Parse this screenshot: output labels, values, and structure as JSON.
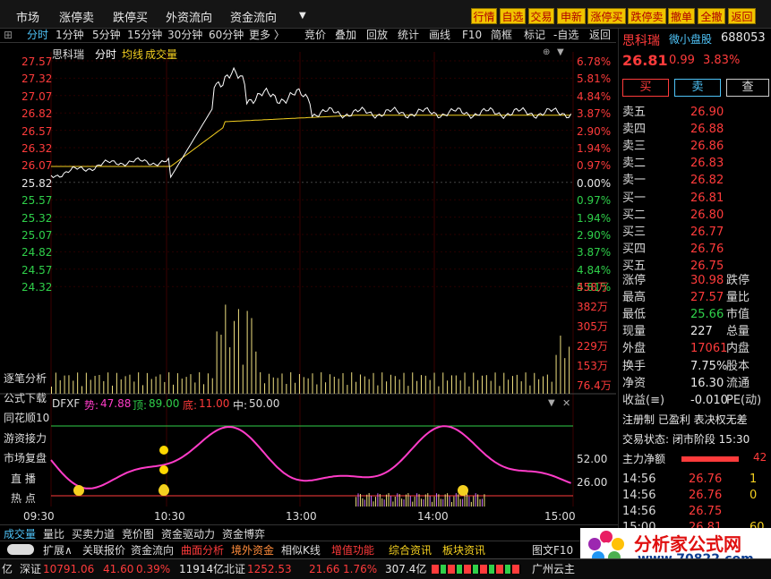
{
  "topbar": {
    "menu": [
      "市场",
      "涨停卖",
      "跌停买",
      "外资流向",
      "资金流向"
    ],
    "buttons": [
      "行情",
      "自选",
      "交易",
      "申新",
      "涨停买",
      "跌停卖",
      "撤单",
      "全撤",
      "返回"
    ]
  },
  "tabs": {
    "periods": [
      "分时",
      "1分钟",
      "5分钟",
      "15分钟",
      "30分钟",
      "60分钟",
      "更多 〉"
    ],
    "tools": [
      "竞价",
      "叠加",
      "回放",
      "统计",
      "画线",
      "F10",
      "简框",
      "标记",
      "-自选",
      "返回"
    ]
  },
  "chart_header": {
    "name": "思科瑞",
    "mode": "分时",
    "avg_label": "均线",
    "vol_label": "成交量"
  },
  "price_axis": {
    "left": [
      "27.57",
      "27.32",
      "27.07",
      "26.82",
      "26.57",
      "26.32",
      "26.07",
      "25.82",
      "25.57",
      "25.32",
      "25.07",
      "24.82",
      "24.57",
      "24.32"
    ],
    "right": [
      "6.78%",
      "5.81%",
      "4.84%",
      "3.87%",
      "2.90%",
      "1.94%",
      "0.97%",
      "0.00%",
      "0.97%",
      "1.94%",
      "2.90%",
      "3.87%",
      "4.84%",
      "5.81%"
    ]
  },
  "volume_axis": [
    "458万",
    "382万",
    "305万",
    "229万",
    "153万",
    "76.4万"
  ],
  "indicator": {
    "name": "DFXF",
    "shi_label": "势:",
    "shi_value": "47.88",
    "ding_label": "顶:",
    "ding_value": "89.00",
    "di_label": "底:",
    "di_value": "11.00",
    "zhong_label": "中:",
    "zhong_value": "50.00",
    "axis": [
      "52.00",
      "26.00"
    ]
  },
  "time_axis": [
    "09:30",
    "10:30",
    "13:00",
    "14:00",
    "15:00"
  ],
  "side_labels": [
    "逐笔分析",
    "公式下载",
    "同花顺10",
    "游资接力",
    "市场复盘",
    "直 播",
    "热 点"
  ],
  "quote": {
    "name": "思科瑞",
    "tag": "微小盘股",
    "code": "688053",
    "price": "26.81",
    "change": "0.99",
    "pct": "3.83%",
    "buy_btn": "买",
    "sell_btn": "卖",
    "view_btn": "查",
    "asks": [
      {
        "l": "卖五",
        "p": "26.90"
      },
      {
        "l": "卖四",
        "p": "26.88"
      },
      {
        "l": "卖三",
        "p": "26.86"
      },
      {
        "l": "卖二",
        "p": "26.83"
      },
      {
        "l": "卖一",
        "p": "26.82"
      }
    ],
    "bids": [
      {
        "l": "买一",
        "p": "26.81"
      },
      {
        "l": "买二",
        "p": "26.80"
      },
      {
        "l": "买三",
        "p": "26.77"
      },
      {
        "l": "买四",
        "p": "26.76"
      },
      {
        "l": "买五",
        "p": "26.75"
      }
    ],
    "stats": [
      {
        "l": "涨停",
        "v": "30.98",
        "l2": "跌停"
      },
      {
        "l": "最高",
        "v": "27.57",
        "l2": "量比"
      },
      {
        "l": "最低",
        "v": "25.66",
        "l2": "市值"
      },
      {
        "l": "现量",
        "v": "227",
        "l2": "总量"
      },
      {
        "l": "外盘",
        "v": "17061",
        "l2": "内盘"
      }
    ],
    "stats2": [
      {
        "l": "换手",
        "v": "7.75%",
        "l2": "股本"
      },
      {
        "l": "净资",
        "v": "16.30",
        "l2": "流通"
      },
      {
        "l": "收益(≡)",
        "v": "-0.010",
        "l2": "PE(动)"
      }
    ],
    "reg": "注册制 已盈利 表决权无差",
    "trade_state": "交易状态: 闭市阶段 15:30",
    "main_net_label": "主力净额",
    "main_net_value": "42",
    "ticks": [
      {
        "t": "14:56",
        "p": "26.76",
        "v": "1"
      },
      {
        "t": "14:56",
        "p": "26.76",
        "v": "0"
      },
      {
        "t": "14:56",
        "p": "26.75",
        "v": ""
      },
      {
        "t": "15:00",
        "p": "26.81",
        "v": "60"
      }
    ]
  },
  "bottom_tabs": [
    "成交量",
    "量比",
    "买卖力道",
    "竞价图",
    "资金驱动力",
    "资金博弈"
  ],
  "bottom_bar": [
    "扩展∧",
    "关联报价",
    "资金流向",
    "曲面分析",
    "境外资金",
    "相似K线",
    "增值功能",
    "综合资讯",
    "板块资讯",
    "图文F10"
  ],
  "status": {
    "prefix": "亿",
    "sz_label": "深证",
    "sz_value": "10791.06",
    "sz_chg": "41.60",
    "sz_pct": "0.39%",
    "sz_amt": "11914亿",
    "bz_label": "北证",
    "bz_value": "1252.53",
    "bz_chg": "21.66",
    "bz_pct": "1.76%",
    "bz_amt": "307.4亿",
    "news": "广州云主"
  },
  "watermark": "分析家公式网 www.70822.com",
  "logo": {
    "cn": "分析家公式网",
    "url": "www.70822.com"
  },
  "colors": {
    "up": "#ff3b3b",
    "down": "#2fd04a",
    "price_line": "#ffffff",
    "avg_line": "#f4d020",
    "indicator": "#ff3cc8"
  }
}
